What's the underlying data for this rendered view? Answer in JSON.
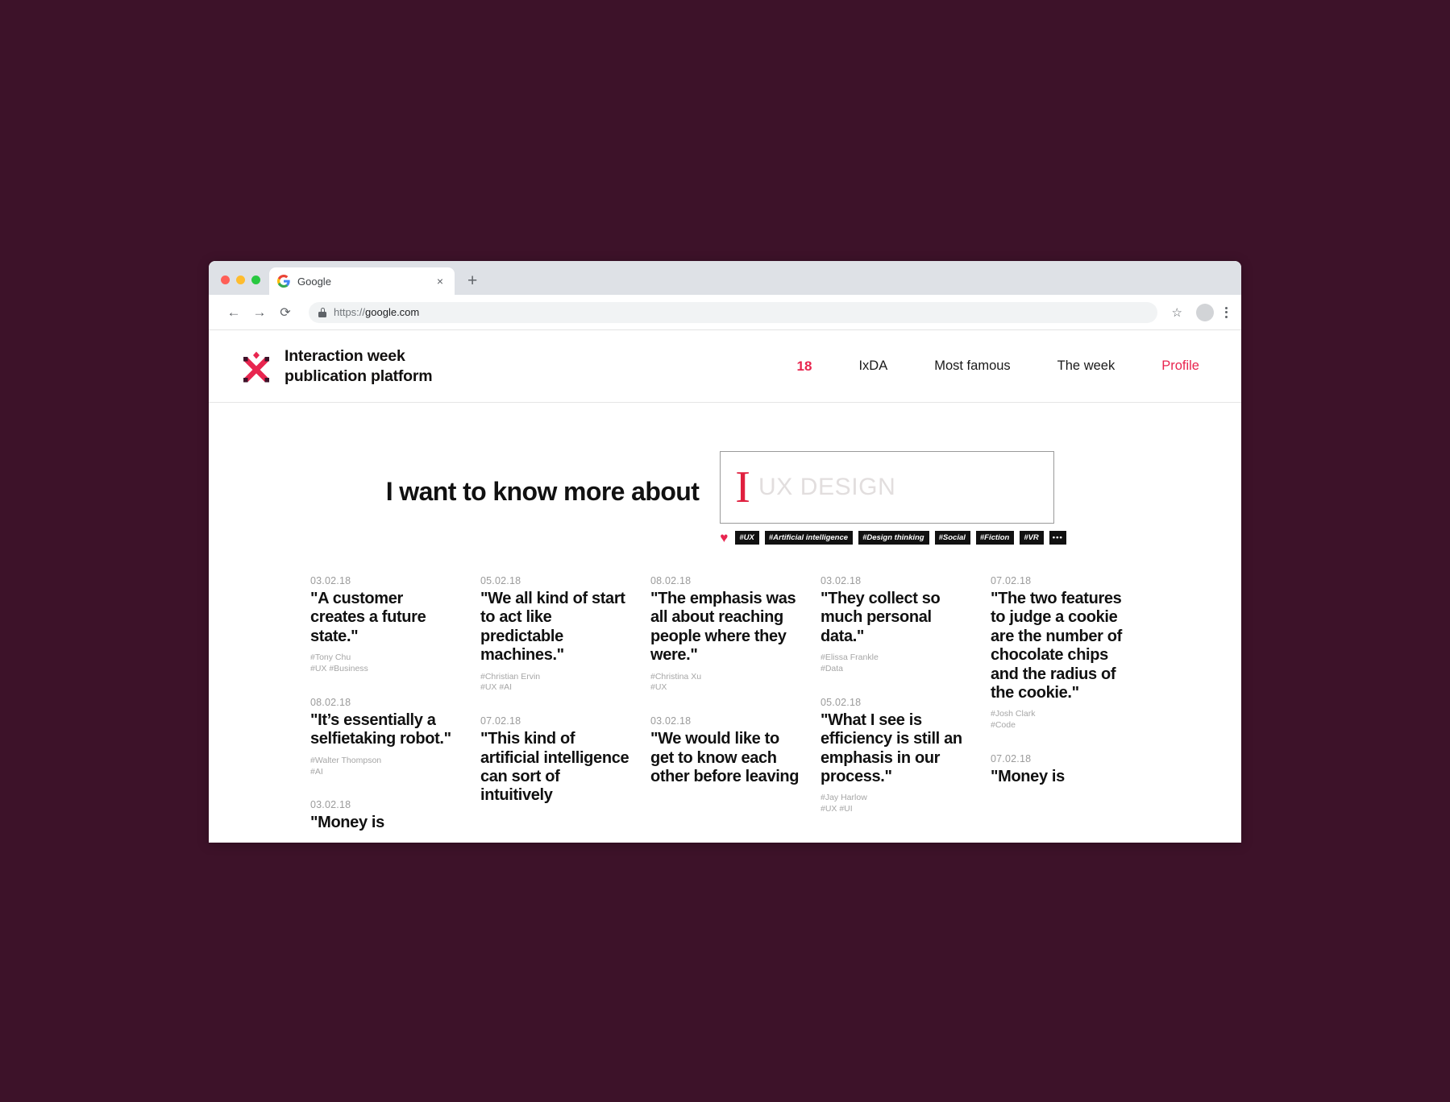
{
  "browser": {
    "tab_title": "Google",
    "tab_close_label": "×",
    "new_tab_label": "+",
    "back_label": "←",
    "forward_label": "→",
    "reload_label": "⟳",
    "url_scheme": "https://",
    "url_domain": "google.com",
    "star_label": "☆"
  },
  "site": {
    "brand_line1": "Interaction week",
    "brand_line2": "publication platform",
    "accent_color": "#e8254f",
    "nav": [
      {
        "label": "18",
        "type": "count"
      },
      {
        "label": "IxDA",
        "type": "link"
      },
      {
        "label": "Most famous",
        "type": "link"
      },
      {
        "label": "The week",
        "type": "link"
      },
      {
        "label": "Profile",
        "type": "profile"
      }
    ]
  },
  "search": {
    "heading": "I want to know more about",
    "caret": "I",
    "placeholder": "UX DESIGN",
    "heart": "♥",
    "tags": [
      "#UX",
      "#Artificial intelligence",
      "#Design thinking",
      "#Social",
      "#Fiction",
      "#VR"
    ],
    "more_label": "•••"
  },
  "quotes": {
    "columns": [
      {
        "items": [
          {
            "date": "03.02.18",
            "text": "\"A customer creates a future state.\"",
            "author": "#Tony Chu",
            "tags": "#UX #Business"
          },
          {
            "date": "08.02.18",
            "text": "\"It’s essentially a selfietaking robot.\"",
            "author": "#Walter Thompson",
            "tags": "#AI"
          },
          {
            "date": "03.02.18",
            "text": "\"Money is",
            "author": "",
            "tags": ""
          }
        ]
      },
      {
        "items": [
          {
            "date": "05.02.18",
            "text": "\"We all kind of start to act like predictable machines.\"",
            "author": "#Christian Ervin",
            "tags": "#UX #AI"
          },
          {
            "date": "07.02.18",
            "text": "\"This kind of artificial intelligence can sort of intuitively",
            "author": "",
            "tags": ""
          }
        ]
      },
      {
        "items": [
          {
            "date": "08.02.18",
            "text": "\"The emphasis was all about reaching people where they were.\"",
            "author": "#Christina Xu",
            "tags": "#UX"
          },
          {
            "date": "03.02.18",
            "text": "\"We would like to get to know each other before leaving",
            "author": "",
            "tags": ""
          }
        ]
      },
      {
        "items": [
          {
            "date": "03.02.18",
            "text": "\"They collect so much personal data.\"",
            "author": "#Elissa Frankle",
            "tags": "#Data"
          },
          {
            "date": "05.02.18",
            "text": "\"What I see is efficiency is still an emphasis in our process.\"",
            "author": "#Jay Harlow",
            "tags": "#UX #UI"
          }
        ]
      },
      {
        "items": [
          {
            "date": "07.02.18",
            "text": "\"The two features to judge a cookie are the number of chocolate chips and the radius of the cookie.\"",
            "author": "#Josh Clark",
            "tags": "#Code"
          },
          {
            "date": "07.02.18",
            "text": "\"Money is",
            "author": "",
            "tags": ""
          }
        ]
      }
    ]
  }
}
